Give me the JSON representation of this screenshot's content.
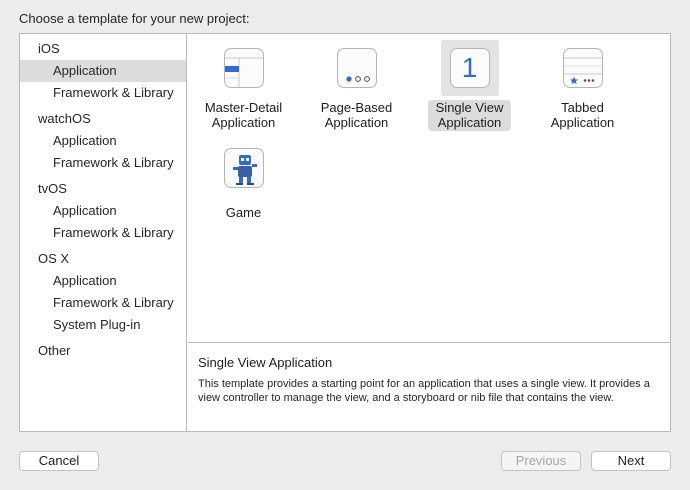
{
  "dialog": {
    "prompt": "Choose a template for your new project:"
  },
  "sidebar": {
    "groups": [
      {
        "title": "iOS",
        "items": [
          "Application",
          "Framework & Library"
        ]
      },
      {
        "title": "watchOS",
        "items": [
          "Application",
          "Framework & Library"
        ]
      },
      {
        "title": "tvOS",
        "items": [
          "Application",
          "Framework & Library"
        ]
      },
      {
        "title": "OS X",
        "items": [
          "Application",
          "Framework & Library",
          "System Plug-in"
        ]
      },
      {
        "title": "Other",
        "items": []
      }
    ],
    "selected": "iOS / Application"
  },
  "templates": [
    {
      "label_line1": "Master-Detail",
      "label_line2": "Application",
      "icon": "master-detail-icon"
    },
    {
      "label_line1": "Page-Based",
      "label_line2": "Application",
      "icon": "page-based-icon"
    },
    {
      "label_line1": "Single View",
      "label_line2": "Application",
      "icon": "single-view-icon",
      "icon_glyph": "1"
    },
    {
      "label_line1": "Tabbed",
      "label_line2": "Application",
      "icon": "tabbed-icon"
    },
    {
      "label_line1": "Game",
      "label_line2": "",
      "icon": "game-icon"
    }
  ],
  "selected_template": "Single View Application",
  "description": {
    "title": "Single View Application",
    "body": "This template provides a starting point for an application that uses a single view. It provides a view controller to manage the view, and a storyboard or nib file that contains the view."
  },
  "buttons": {
    "cancel": "Cancel",
    "previous": "Previous",
    "next": "Next"
  },
  "colors": {
    "accent_blue": "#2f6bd1",
    "selection_gray": "#dcdcdc"
  }
}
